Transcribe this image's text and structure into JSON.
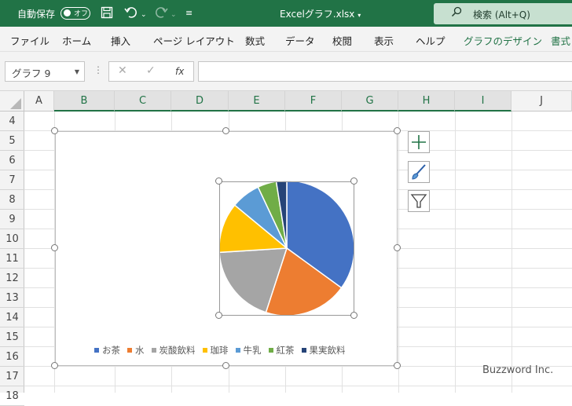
{
  "titlebar": {
    "autosave_label": "自動保存",
    "autosave_state": "オフ",
    "filename": "Excelグラフ.xlsx",
    "search_placeholder": "検索 (Alt+Q)"
  },
  "menu": [
    "ファイル",
    "ホーム",
    "挿入",
    "ページ レイアウト",
    "数式",
    "データ",
    "校閲",
    "表示",
    "ヘルプ",
    "グラフのデザイン",
    "書式"
  ],
  "formula_bar": {
    "name_box": "グラフ 9",
    "formula": ""
  },
  "columns": [
    "A",
    "B",
    "C",
    "D",
    "E",
    "F",
    "G",
    "H",
    "I",
    "J"
  ],
  "rows": [
    "4",
    "5",
    "6",
    "7",
    "8",
    "9",
    "10",
    "11",
    "12",
    "13",
    "14",
    "15",
    "16",
    "17",
    "18"
  ],
  "side_buttons": [
    "chart-elements-plus-icon",
    "chart-styles-brush-icon",
    "chart-filters-funnel-icon"
  ],
  "chart_data": {
    "type": "pie",
    "title": "",
    "categories": [
      "お茶",
      "水",
      "炭酸飲料",
      "珈琲",
      "牛乳",
      "紅茶",
      "果実飲料"
    ],
    "values": [
      35,
      20,
      19,
      12,
      7,
      4.5,
      2.5
    ],
    "colors": [
      "#4472C4",
      "#ED7D31",
      "#A5A5A5",
      "#FFC000",
      "#5B9BD5",
      "#70AD47",
      "#264478"
    ],
    "legend": "bottom"
  },
  "watermark": "Buzzword Inc."
}
